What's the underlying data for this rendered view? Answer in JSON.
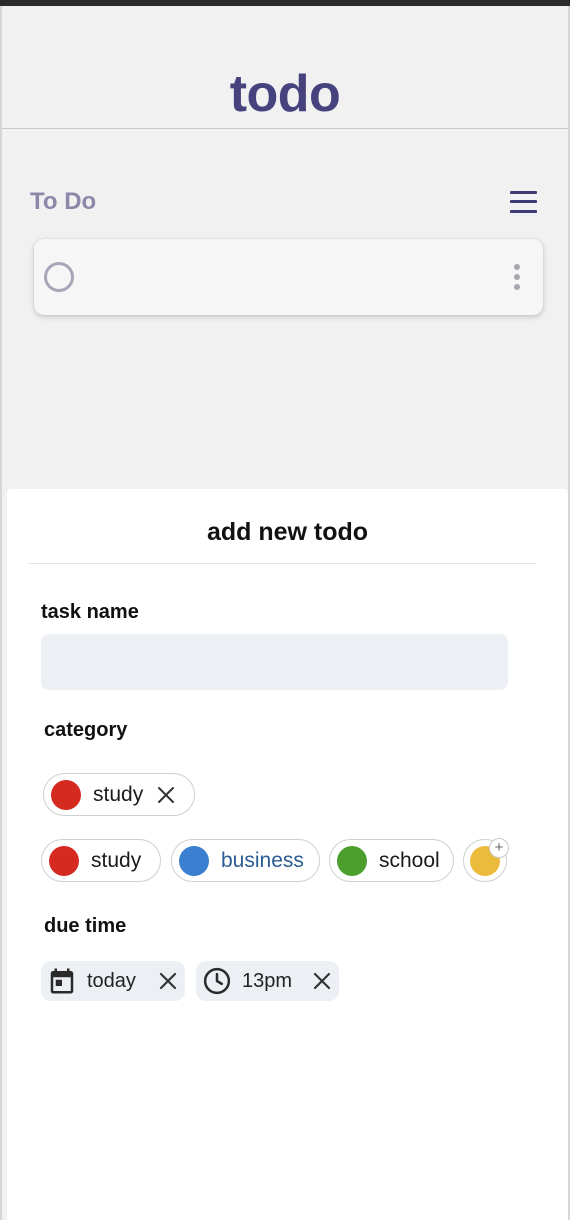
{
  "app": {
    "title": "todo"
  },
  "list": {
    "title": "To Do",
    "items": [
      {
        "text": "",
        "completed": false
      }
    ]
  },
  "sheet": {
    "title": "add new todo",
    "task_name": {
      "label": "task name",
      "value": "",
      "placeholder": ""
    },
    "category": {
      "label": "category",
      "selected": [
        {
          "label": "study",
          "color": "#d42a20"
        }
      ],
      "options": [
        {
          "label": "study",
          "color": "#d42a20",
          "text_color": "#1b1b1b"
        },
        {
          "label": "business",
          "color": "#3a7fd0",
          "text_color": "#2b5c93"
        },
        {
          "label": "school",
          "color": "#4c9f2c",
          "text_color": "#1b1b1b"
        }
      ],
      "add_color": "#ebbb3c"
    },
    "due_time": {
      "label": "due time",
      "date": {
        "label": "today",
        "icon": "calendar-icon"
      },
      "time": {
        "label": "13pm",
        "icon": "clock-icon"
      }
    }
  },
  "colors": {
    "brand": "#46427e",
    "list_title": "#8b88aa",
    "background": "#f1f1f2",
    "input_bg": "#ecf0f4"
  }
}
